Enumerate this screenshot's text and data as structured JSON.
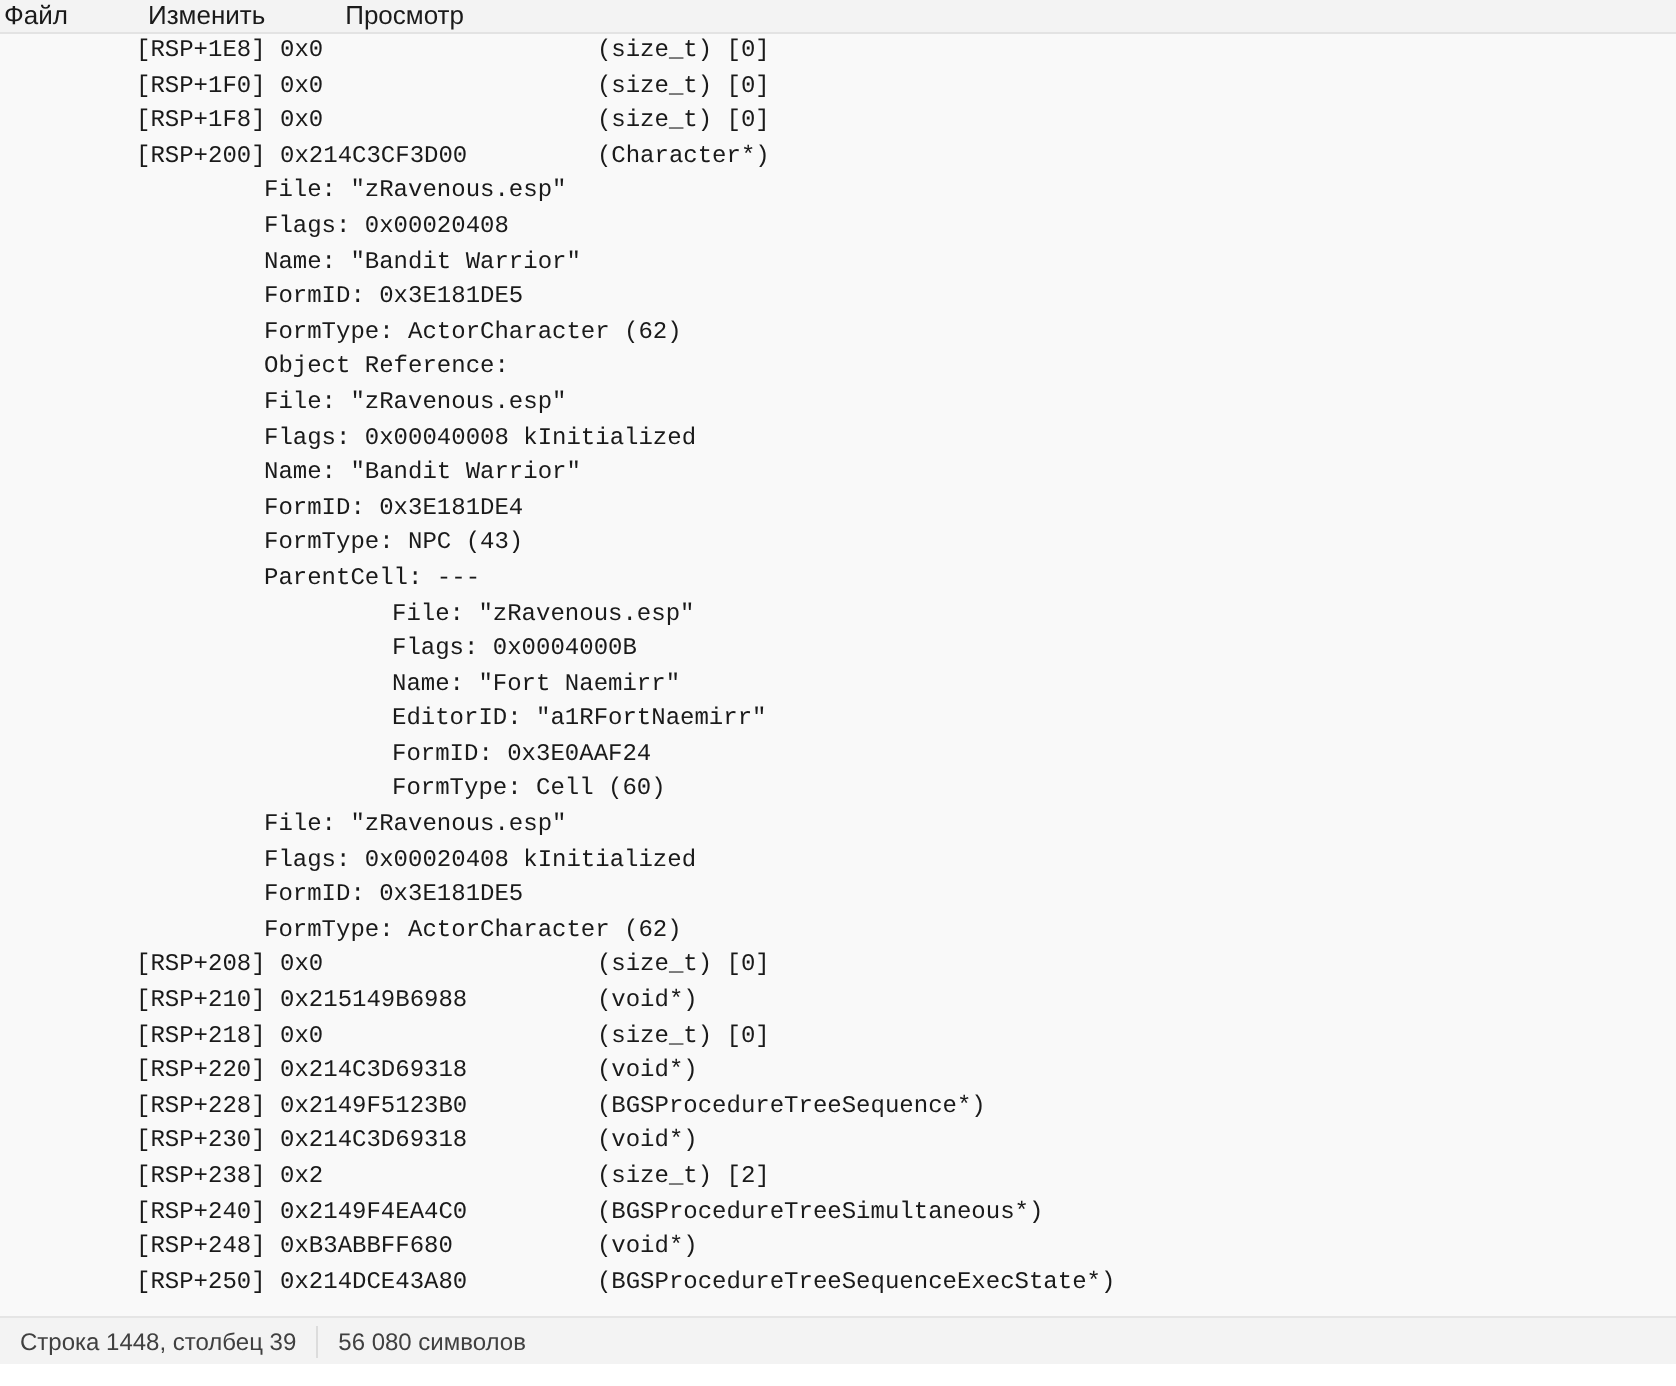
{
  "menu": [
    {
      "label": "Файл"
    },
    {
      "label": "Изменить"
    },
    {
      "label": "Просмотр"
    }
  ],
  "lines": [
    {
      "text": "[RSP+1E8] 0x0                   (size_t) [0]"
    },
    {
      "text": "[RSP+1F0] 0x0                   (size_t) [0]"
    },
    {
      "text": "[RSP+1F8] 0x0                   (size_t) [0]"
    },
    {
      "text": "[RSP+200] 0x214C3CF3D00         (Character*)",
      "children": [
        {
          "text": "File: \"zRavenous.esp\""
        },
        {
          "text": "Flags: 0x00020408"
        },
        {
          "text": "Name: \"Bandit Warrior\""
        },
        {
          "text": "FormID: 0x3E181DE5"
        },
        {
          "text": "FormType: ActorCharacter (62)"
        },
        {
          "text": "Object Reference:"
        },
        {
          "text": "File: \"zRavenous.esp\""
        },
        {
          "text": "Flags: 0x00040008 kInitialized"
        },
        {
          "text": "Name: \"Bandit Warrior\""
        },
        {
          "text": "FormID: 0x3E181DE4"
        },
        {
          "text": "FormType: NPC (43)"
        },
        {
          "text": "ParentCell: ---",
          "children": [
            {
              "text": "File: \"zRavenous.esp\""
            },
            {
              "text": "Flags: 0x0004000B"
            },
            {
              "text": "Name: \"Fort Naemirr\""
            },
            {
              "text": "EditorID: \"a1RFortNaemirr\""
            },
            {
              "text": "FormID: 0x3E0AAF24"
            },
            {
              "text": "FormType: Cell (60)"
            }
          ]
        },
        {
          "text": "File: \"zRavenous.esp\""
        },
        {
          "text": "Flags: 0x00020408 kInitialized"
        },
        {
          "text": "FormID: 0x3E181DE5"
        },
        {
          "text": "FormType: ActorCharacter (62)"
        }
      ]
    },
    {
      "text": "[RSP+208] 0x0                   (size_t) [0]"
    },
    {
      "text": "[RSP+210] 0x215149B6988         (void*)"
    },
    {
      "text": "[RSP+218] 0x0                   (size_t) [0]"
    },
    {
      "text": "[RSP+220] 0x214C3D69318         (void*)"
    },
    {
      "text": "[RSP+228] 0x2149F5123B0         (BGSProcedureTreeSequence*)"
    },
    {
      "text": "[RSP+230] 0x214C3D69318         (void*)"
    },
    {
      "text": "[RSP+238] 0x2                   (size_t) [2]"
    },
    {
      "text": "[RSP+240] 0x2149F4EA4C0         (BGSProcedureTreeSimultaneous*)"
    },
    {
      "text": "[RSP+248] 0xB3ABBFF680          (void*)"
    },
    {
      "text": "[RSP+250] 0x214DCE43A80         (BGSProcedureTreeSequenceExecState*)"
    }
  ],
  "status_bar": {
    "position": "Строка 1448, столбец 39",
    "char_count": "56 080 символов"
  }
}
